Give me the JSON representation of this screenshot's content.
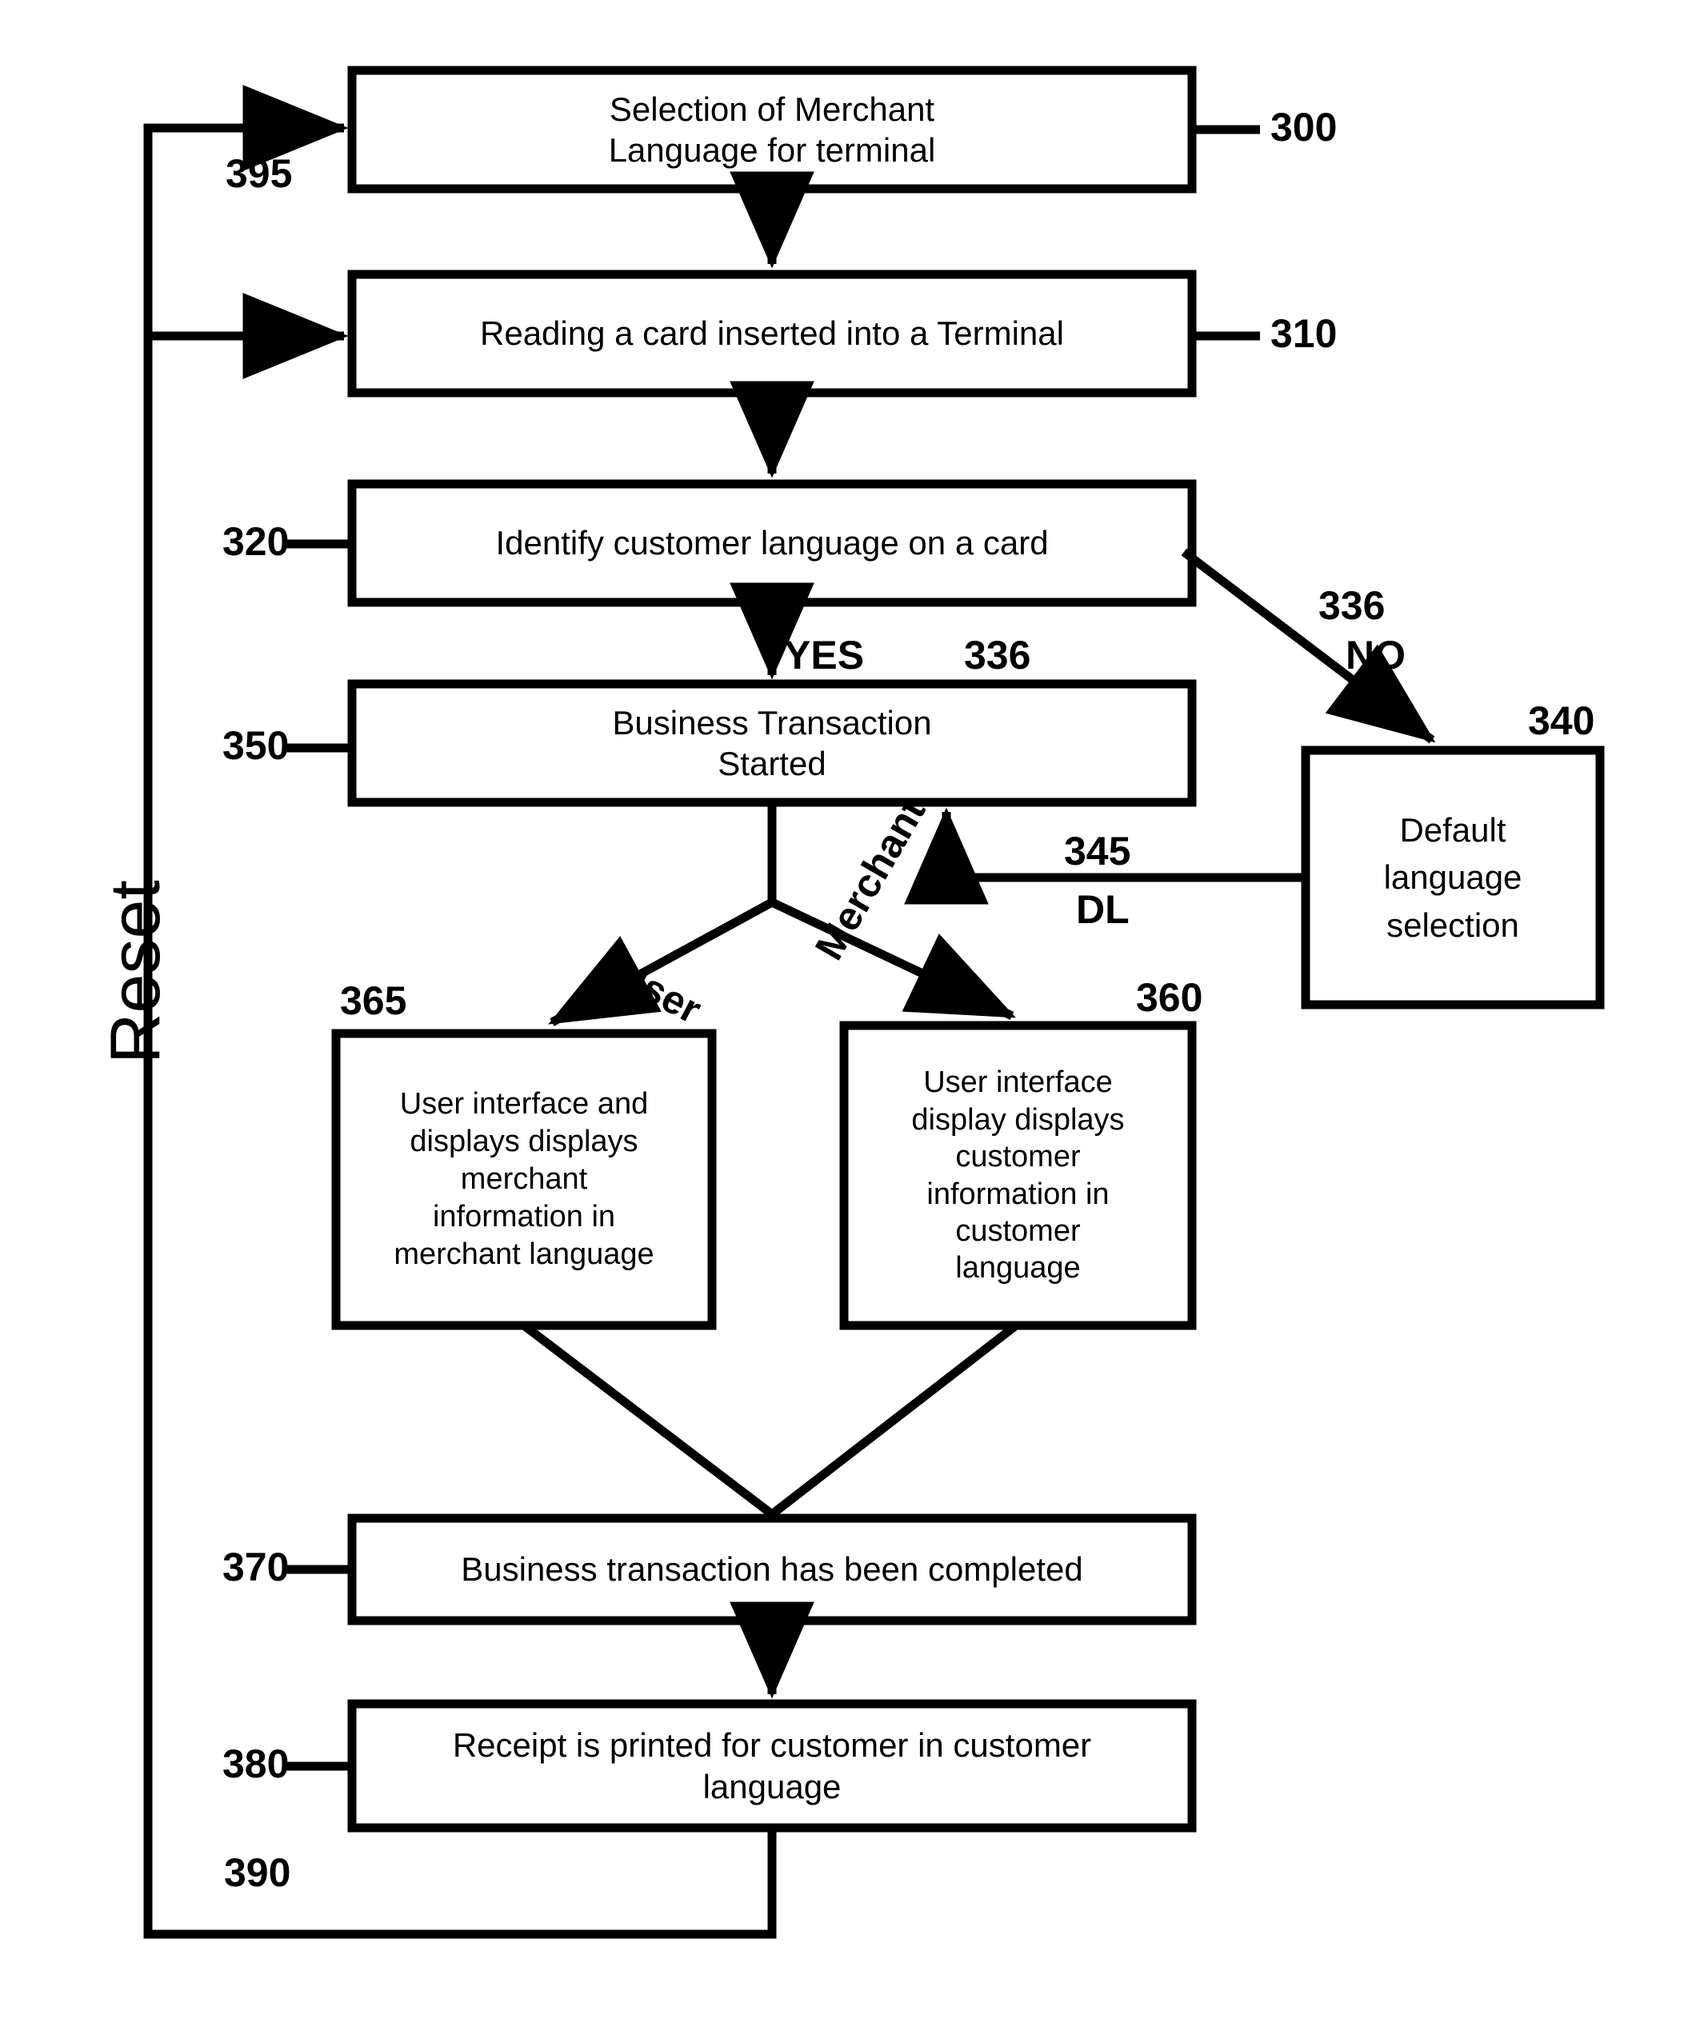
{
  "figure": {
    "type": "flowchart",
    "title_text": "",
    "reset_label": "Reset"
  },
  "nodes": [
    {
      "id": "300",
      "ref": "300",
      "lines": [
        "Selection of Merchant",
        "Language for terminal"
      ]
    },
    {
      "id": "310",
      "ref": "310",
      "lines": [
        "Reading a card inserted into a Terminal"
      ]
    },
    {
      "id": "320",
      "ref": "320",
      "lines": [
        "Identify customer language on a card"
      ]
    },
    {
      "id": "350",
      "ref": "350",
      "lines": [
        "Business Transaction",
        "Started"
      ]
    },
    {
      "id": "340",
      "ref": "340",
      "lines": [
        "Default",
        "language",
        "selection"
      ]
    },
    {
      "id": "365",
      "ref": "365",
      "lines": [
        "User interface and",
        "displays displays",
        "merchant",
        "information in",
        "merchant language"
      ]
    },
    {
      "id": "360",
      "ref": "360",
      "lines": [
        "User interface",
        "display displays",
        "customer",
        "information in",
        "customer",
        "language"
      ]
    },
    {
      "id": "370",
      "ref": "370",
      "lines": [
        "Business transaction has been completed"
      ]
    },
    {
      "id": "380",
      "ref": "380",
      "lines": [
        "Receipt is printed for customer in customer",
        "language"
      ]
    }
  ],
  "edge_labels": {
    "yes": "YES",
    "yes_ref": "336",
    "no_ref": "336",
    "no": "NO",
    "dl_ref": "345",
    "dl": "DL",
    "user": "User",
    "merchant": "Merchant"
  },
  "ref_labels": {
    "n395": "395",
    "n390": "390",
    "n300": "300",
    "n310": "310",
    "n320": "320",
    "n350": "350",
    "n340": "340",
    "n365": "365",
    "n360": "360",
    "n370": "370",
    "n380": "380"
  },
  "colors": {
    "stroke": "#000000",
    "fill": "#ffffff",
    "background": "#ffffff"
  }
}
